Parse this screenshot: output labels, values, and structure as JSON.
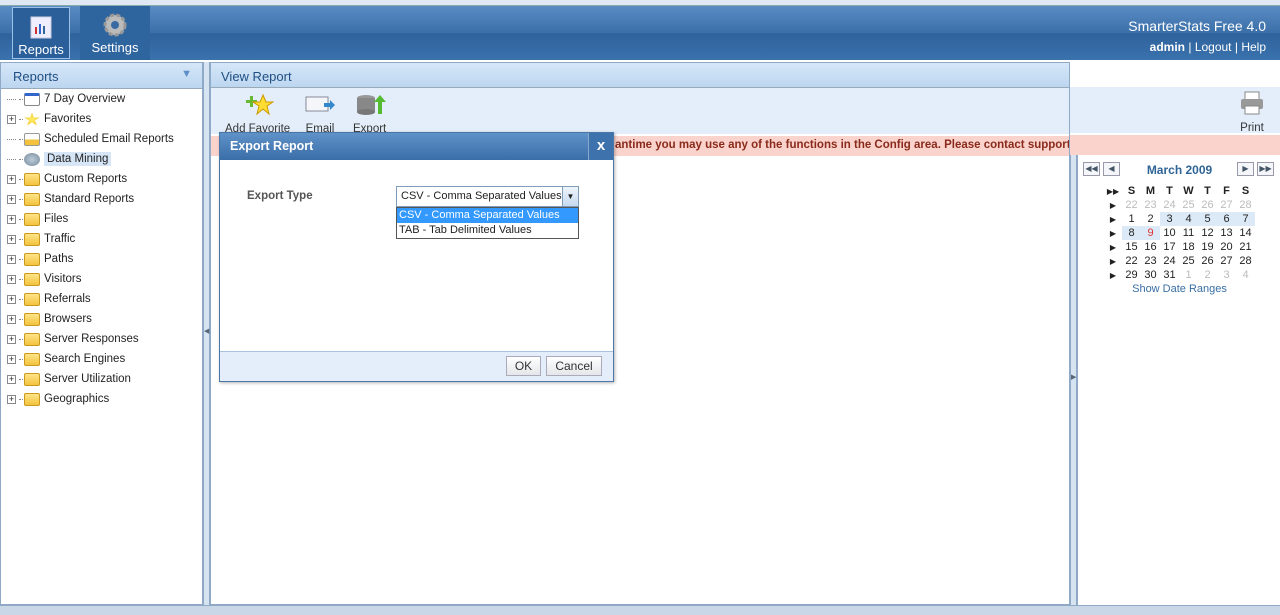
{
  "header": {
    "app_title": "SmarterStats Free 4.0",
    "user": "admin",
    "links": [
      "Logout",
      "Help"
    ],
    "tabs": [
      {
        "label": "Reports",
        "icon": "reports-icon"
      },
      {
        "label": "Settings",
        "icon": "gear-icon"
      }
    ]
  },
  "sidebar": {
    "title": "Reports",
    "items": [
      {
        "label": "7 Day Overview",
        "icon": "calendar-icon",
        "expandable": false
      },
      {
        "label": "Favorites",
        "icon": "star-icon",
        "expandable": true
      },
      {
        "label": "Scheduled Email Reports",
        "icon": "scheduled-report-icon",
        "expandable": false
      },
      {
        "label": "Data Mining",
        "icon": "data-mining-icon",
        "expandable": false,
        "selected": true
      },
      {
        "label": "Custom Reports",
        "icon": "folder-icon",
        "expandable": true
      },
      {
        "label": "Standard Reports",
        "icon": "folder-icon",
        "expandable": true
      },
      {
        "label": "Files",
        "icon": "folder-icon",
        "expandable": true
      },
      {
        "label": "Traffic",
        "icon": "folder-icon",
        "expandable": true
      },
      {
        "label": "Paths",
        "icon": "folder-icon",
        "expandable": true
      },
      {
        "label": "Visitors",
        "icon": "folder-icon",
        "expandable": true
      },
      {
        "label": "Referrals",
        "icon": "folder-icon",
        "expandable": true
      },
      {
        "label": "Browsers",
        "icon": "folder-icon",
        "expandable": true
      },
      {
        "label": "Server Responses",
        "icon": "folder-icon",
        "expandable": true
      },
      {
        "label": "Search Engines",
        "icon": "folder-icon",
        "expandable": true
      },
      {
        "label": "Server Utilization",
        "icon": "folder-icon",
        "expandable": true
      },
      {
        "label": "Geographics",
        "icon": "folder-icon",
        "expandable": true
      }
    ]
  },
  "main": {
    "title": "View Report",
    "toolbar": {
      "add_favorite": "Add Favorite",
      "email": "Email",
      "export": "Export",
      "print": "Print"
    },
    "warning": "antime you may use any of the functions in the Config area. Please contact support for assistance."
  },
  "calendar": {
    "month": "March 2009",
    "weekdays": [
      "S",
      "M",
      "T",
      "W",
      "T",
      "F",
      "S"
    ],
    "weeks": [
      [
        "22",
        "23",
        "24",
        "25",
        "26",
        "27",
        "28"
      ],
      [
        "1",
        "2",
        "3",
        "4",
        "5",
        "6",
        "7"
      ],
      [
        "8",
        "9",
        "10",
        "11",
        "12",
        "13",
        "14"
      ],
      [
        "15",
        "16",
        "17",
        "18",
        "19",
        "20",
        "21"
      ],
      [
        "22",
        "23",
        "24",
        "25",
        "26",
        "27",
        "28"
      ],
      [
        "29",
        "30",
        "31",
        "1",
        "2",
        "3",
        "4"
      ]
    ],
    "today": "9",
    "show_date_ranges": "Show Date Ranges"
  },
  "dialog": {
    "title": "Export Report",
    "close": "x",
    "label": "Export Type",
    "selected": "CSV - Comma Separated Values",
    "options": [
      "CSV - Comma Separated Values",
      "TAB - Tab Delimited Values"
    ],
    "ok": "OK",
    "cancel": "Cancel"
  }
}
